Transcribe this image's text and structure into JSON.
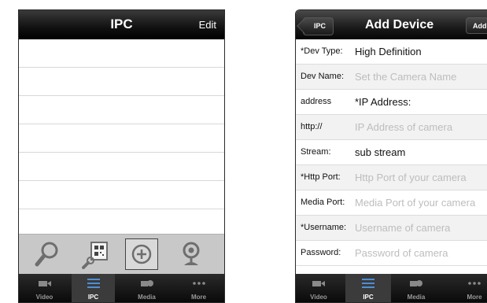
{
  "left": {
    "title": "IPC",
    "edit_label": "Edit",
    "toolbar_icons": [
      "search-icon",
      "qr-scan-icon",
      "add-circle-icon",
      "webcam-icon"
    ]
  },
  "tabs": [
    {
      "label": "Video",
      "icon": "camera-icon"
    },
    {
      "label": "IPC",
      "icon": "list-icon",
      "active": true
    },
    {
      "label": "Media",
      "icon": "media-icon"
    },
    {
      "label": "More",
      "icon": "more-icon"
    }
  ],
  "right": {
    "back_label": "IPC",
    "title": "Add Device",
    "add_label": "Add",
    "fields": [
      {
        "label": "*Dev Type:",
        "value": "High Definition",
        "placeholder": false,
        "chevron": true
      },
      {
        "label": "Dev Name:",
        "value": "Set the Camera Name",
        "placeholder": true,
        "chevron": false
      },
      {
        "label": "address",
        "value": "*IP Address:",
        "placeholder": false,
        "chevron": true
      },
      {
        "label": "http://",
        "value": "IP Address of camera",
        "placeholder": true,
        "chevron": false
      },
      {
        "label": "Stream:",
        "value": "sub stream",
        "placeholder": false,
        "chevron": true
      },
      {
        "label": "*Http Port:",
        "value": "Http Port of your camera",
        "placeholder": true,
        "chevron": false
      },
      {
        "label": "Media Port:",
        "value": "Media Port of your camera",
        "placeholder": true,
        "chevron": false
      },
      {
        "label": "*Username:",
        "value": "Username of camera",
        "placeholder": true,
        "chevron": false
      },
      {
        "label": "Password:",
        "value": "Password of camera",
        "placeholder": true,
        "chevron": false
      }
    ]
  }
}
